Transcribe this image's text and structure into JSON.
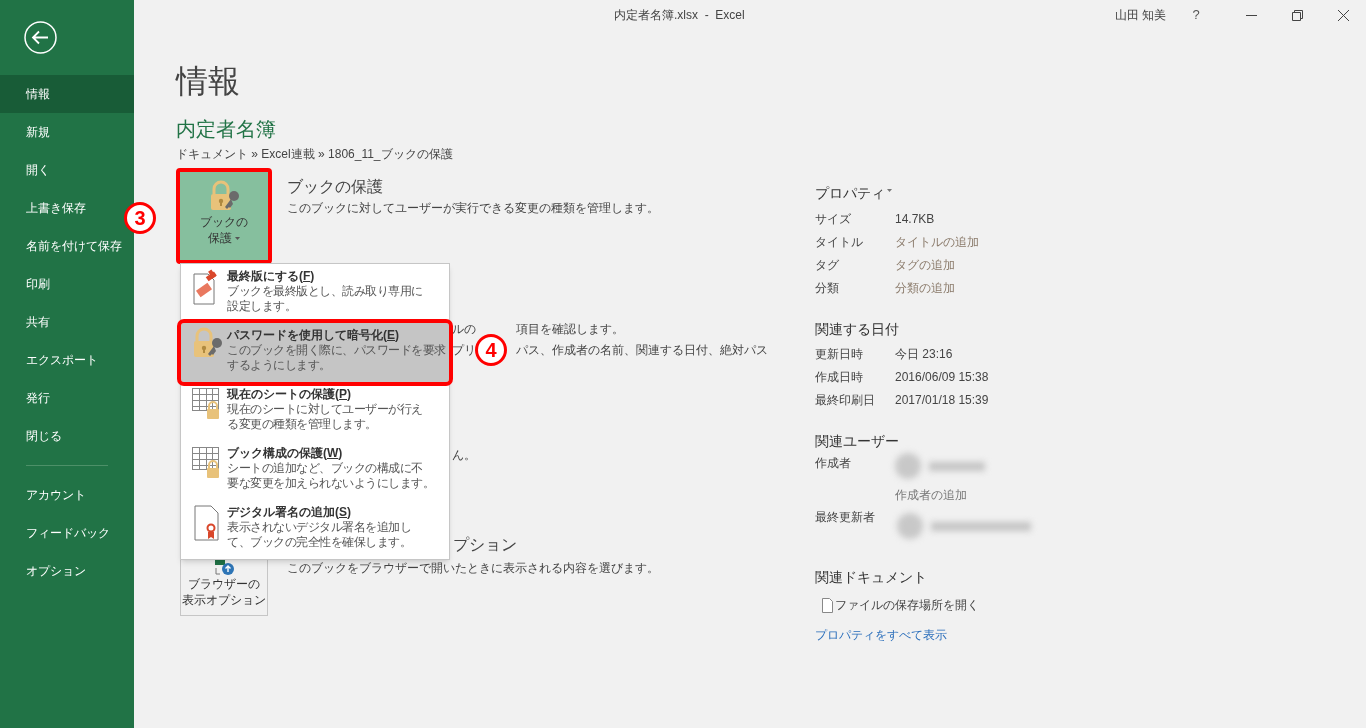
{
  "window": {
    "title": "内定者名簿.xlsx  -  Excel",
    "user": "山田 知美",
    "help": "?"
  },
  "sidebar": {
    "items": [
      {
        "label": "情報",
        "selected": true
      },
      {
        "label": "新規",
        "selected": false
      },
      {
        "label": "開く",
        "selected": false
      },
      {
        "label": "上書き保存",
        "selected": false
      },
      {
        "label": "名前を付けて保存",
        "selected": false
      },
      {
        "label": "印刷",
        "selected": false
      },
      {
        "label": "共有",
        "selected": false
      },
      {
        "label": "エクスポート",
        "selected": false
      },
      {
        "label": "発行",
        "selected": false
      },
      {
        "label": "閉じる",
        "selected": false
      }
    ],
    "footer_items": [
      {
        "label": "アカウント",
        "selected": false
      },
      {
        "label": "フィードバック",
        "selected": false
      },
      {
        "label": "オプション",
        "selected": false
      }
    ]
  },
  "page": {
    "title": "情報",
    "document": "内定者名簿",
    "breadcrumb": "ドキュメント » Excel連載 » 1806_11_ブックの保護"
  },
  "protect": {
    "button": [
      "ブックの",
      "保護"
    ],
    "title": "ブックの保護",
    "description": "このブックに対してユーザーが実行できる変更の種類を管理します。",
    "step": "3"
  },
  "hidden_section": {
    "line_1": [
      "ルの",
      "項目を確認します。"
    ],
    "line_2": [
      "プリ",
      "パス、作成者の名前、関連する日付、絶対パス"
    ],
    "line_3": "ん。"
  },
  "menu": {
    "step": "4",
    "items": [
      {
        "kind": "stamp",
        "title": "最終版にする(F)",
        "description": [
          "ブックを最終版とし、読み取り専用に",
          "設定します。"
        ],
        "selected": false
      },
      {
        "kind": "lock",
        "title": "パスワードを使用して暗号化(E)",
        "description": [
          "このブックを開く際に、パスワードを要求",
          "するようにします。"
        ],
        "selected": true
      },
      {
        "kind": "sheet-lock",
        "title": "現在のシートの保護(P)",
        "description": [
          "現在のシートに対してユーザーが行え",
          "る変更の種類を管理します。"
        ],
        "selected": false
      },
      {
        "kind": "sheet-lock",
        "title": "ブック構成の保護(W)",
        "description": [
          "シートの追加など、ブックの構成に不",
          "要な変更を加えられないようにします。"
        ],
        "selected": false
      },
      {
        "kind": "signature",
        "title": "デジタル署名の追加(S)",
        "description": [
          "表示されないデジタル署名を追加し",
          "て、ブックの完全性を確保します。"
        ],
        "selected": false
      }
    ]
  },
  "browser": {
    "button": [
      "ブラウザーの",
      "表示オプション"
    ],
    "title": "プション",
    "description": "このブックをブラウザーで開いたときに表示される内容を選びます。"
  },
  "properties": {
    "title": "プロパティ",
    "rows": [
      {
        "label": "サイズ",
        "value": "14.7KB",
        "kind": "value"
      },
      {
        "label": "タイトル",
        "value": "タイトルの追加",
        "kind": "add"
      },
      {
        "label": "タグ",
        "value": "タグの追加",
        "kind": "add"
      },
      {
        "label": "分類",
        "value": "分類の追加",
        "kind": "add"
      }
    ]
  },
  "dates": {
    "title": "関連する日付",
    "rows": [
      {
        "label": "更新日時",
        "value": "今日 23:16"
      },
      {
        "label": "作成日時",
        "value": "2016/06/09 15:38"
      },
      {
        "label": "最終印刷日",
        "value": "2017/01/18 15:39"
      }
    ]
  },
  "people": {
    "title": "関連ユーザー",
    "author_label": "作成者",
    "add_author": "作成者の追加",
    "modifier_label": "最終更新者"
  },
  "documents": {
    "title": "関連ドキュメント",
    "open_location": "ファイルの保存場所を開く",
    "show_all": "プロパティをすべて表示"
  }
}
